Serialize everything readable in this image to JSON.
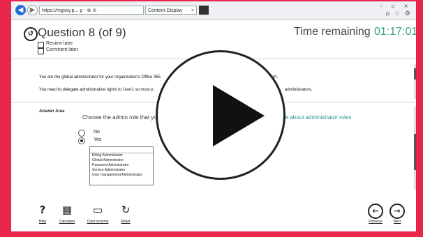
{
  "browser": {
    "address": "https://mgsxy.p... ρ - ⊕ ⊘",
    "tab_title": "Content Display",
    "tab_close": "×",
    "window_controls": "– ▫ ×",
    "tool_icons": "⌂ ☆ ⚙"
  },
  "header": {
    "back_icon": "↺",
    "question_title": "Question 8 (of 9)",
    "time_label": "Time remaining",
    "time_value": "01:17:01",
    "review_label": "Review later",
    "comment_label": "Comment later"
  },
  "question": {
    "line1_left": "You are the global administrator for your organization's Office 365",
    "line1_right": "port.",
    "line2_left": "You need to delegate administrative rights to User1 so most p",
    "line2_right": "administrators."
  },
  "answer": {
    "area_label": "Answer Area",
    "prompt": "Choose the admin role that yo",
    "learn_more": "re about administrator roles",
    "radio_no": "No",
    "radio_yes": "Yes",
    "selected": "Yes",
    "dropdown_options": [
      "Billing Administrator",
      "Global Administrator",
      "Password Administrator",
      "Service Administrator",
      "User management Administrator"
    ]
  },
  "toolbar": {
    "help_icon": "?",
    "help_label": "Help",
    "calculator_icon": "▦",
    "calculator_label": "Calculator",
    "color_icon": "▭",
    "color_label": "Color scheme",
    "reset_icon": "↻",
    "reset_label": "Reset",
    "previous_icon": "←",
    "previous_label": "Previous",
    "next_icon": "→",
    "next_label": "Next"
  },
  "overlay": {
    "play_icon": "play-icon"
  },
  "colors": {
    "border": "#e8264a",
    "accent": "#3aa17e",
    "link": "#2a8f8a"
  }
}
